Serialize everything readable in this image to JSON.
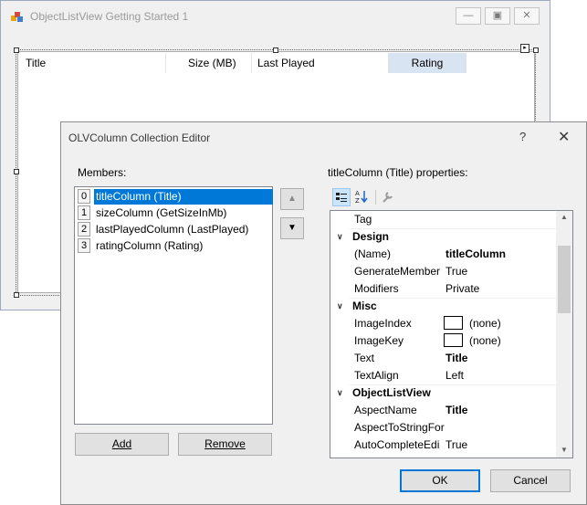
{
  "bg_window": {
    "title": "ObjectListView Getting Started 1",
    "columns": [
      "Title",
      "Size (MB)",
      "Last Played",
      "Rating"
    ]
  },
  "dialog": {
    "title": "OLVColumn Collection Editor",
    "help": "?",
    "members_label": "Members:",
    "members": [
      {
        "index": "0",
        "label": "titleColumn (Title)",
        "selected": true
      },
      {
        "index": "1",
        "label": "sizeColumn (GetSizeInMb)",
        "selected": false
      },
      {
        "index": "2",
        "label": "lastPlayedColumn (LastPlayed)",
        "selected": false
      },
      {
        "index": "3",
        "label": "ratingColumn (Rating)",
        "selected": false
      }
    ],
    "add_label": "Add",
    "remove_label": "Remove",
    "properties_label": "titleColumn (Title) properties:",
    "ok_label": "OK",
    "cancel_label": "Cancel",
    "grid": {
      "r0": {
        "name": "Tag",
        "value": ""
      },
      "cat_design": "Design",
      "r1": {
        "name": "(Name)",
        "value": "titleColumn"
      },
      "r2": {
        "name": "GenerateMember",
        "value": "True"
      },
      "r3": {
        "name": "Modifiers",
        "value": "Private"
      },
      "cat_misc": "Misc",
      "r4": {
        "name": "ImageIndex",
        "value": "(none)"
      },
      "r5": {
        "name": "ImageKey",
        "value": "(none)"
      },
      "r6": {
        "name": "Text",
        "value": "Title"
      },
      "r7": {
        "name": "TextAlign",
        "value": "Left"
      },
      "cat_olv": "ObjectListView",
      "r8": {
        "name": "AspectName",
        "value": "Title"
      },
      "r9": {
        "name": "AspectToStringFor",
        "value": ""
      },
      "r10": {
        "name": "AutoCompleteEdi",
        "value": "True"
      }
    }
  },
  "colors": {
    "selection": "#0078d7",
    "accent_button": "#0078d7"
  },
  "icons": [
    "app-icon",
    "minimize-icon",
    "maximize-icon",
    "close-icon",
    "smart-tag-icon",
    "arrow-up-icon",
    "arrow-down-icon",
    "categorized-icon",
    "alphabetical-icon",
    "property-pages-icon",
    "chevron-down-icon",
    "scroll-up-icon",
    "scroll-down-icon"
  ]
}
